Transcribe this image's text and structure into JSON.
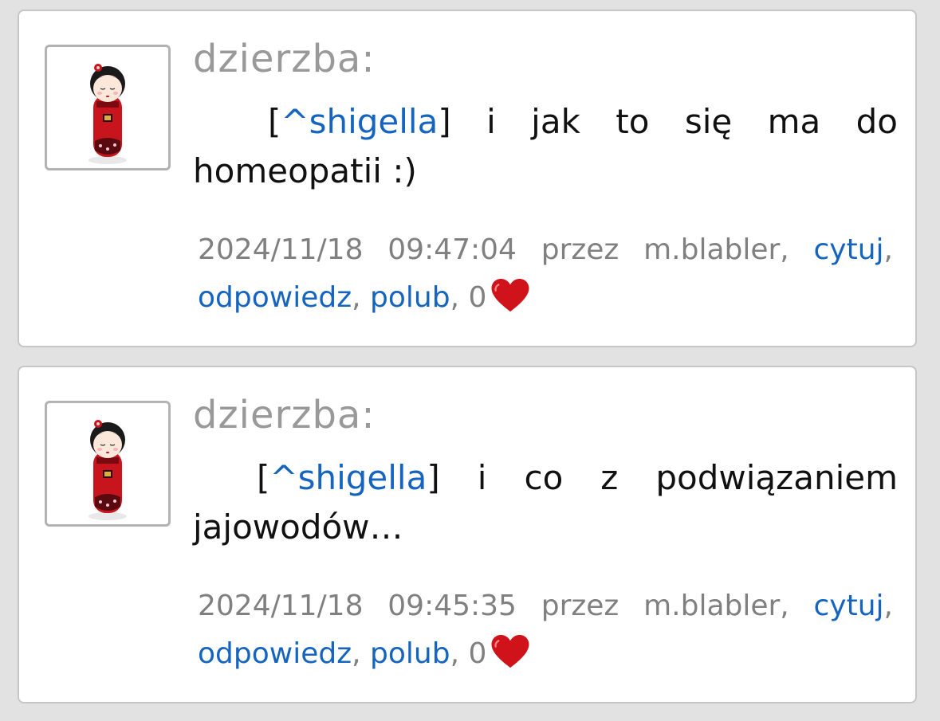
{
  "comments": [
    {
      "author": "dzierzba:",
      "quote_open": "[",
      "quote_link": "^shigella",
      "quote_close": "]",
      "text": " i jak to się ma do homeopatii :)",
      "date": "2024/11/18",
      "time": "09:47:04",
      "by_label": "przez",
      "by_user": "m.blabler,",
      "actions": {
        "quote": "cytuj",
        "reply": "odpowiedz",
        "like": "polub"
      },
      "separator": ",",
      "likes": "0",
      "like_icon": "heart-icon"
    },
    {
      "author": "dzierzba:",
      "quote_open": "[",
      "quote_link": "^shigella",
      "quote_close": "]",
      "text": " i co z podwiązaniem jajowodów…",
      "date": "2024/11/18",
      "time": "09:45:35",
      "by_label": "przez",
      "by_user": "m.blabler,",
      "actions": {
        "quote": "cytuj",
        "reply": "odpowiedz",
        "like": "polub"
      },
      "separator": ",",
      "likes": "0",
      "like_icon": "heart-icon"
    }
  ],
  "colors": {
    "link": "#1565c0",
    "author": "#999999",
    "meta": "#808080",
    "heart": "#d0121b"
  }
}
